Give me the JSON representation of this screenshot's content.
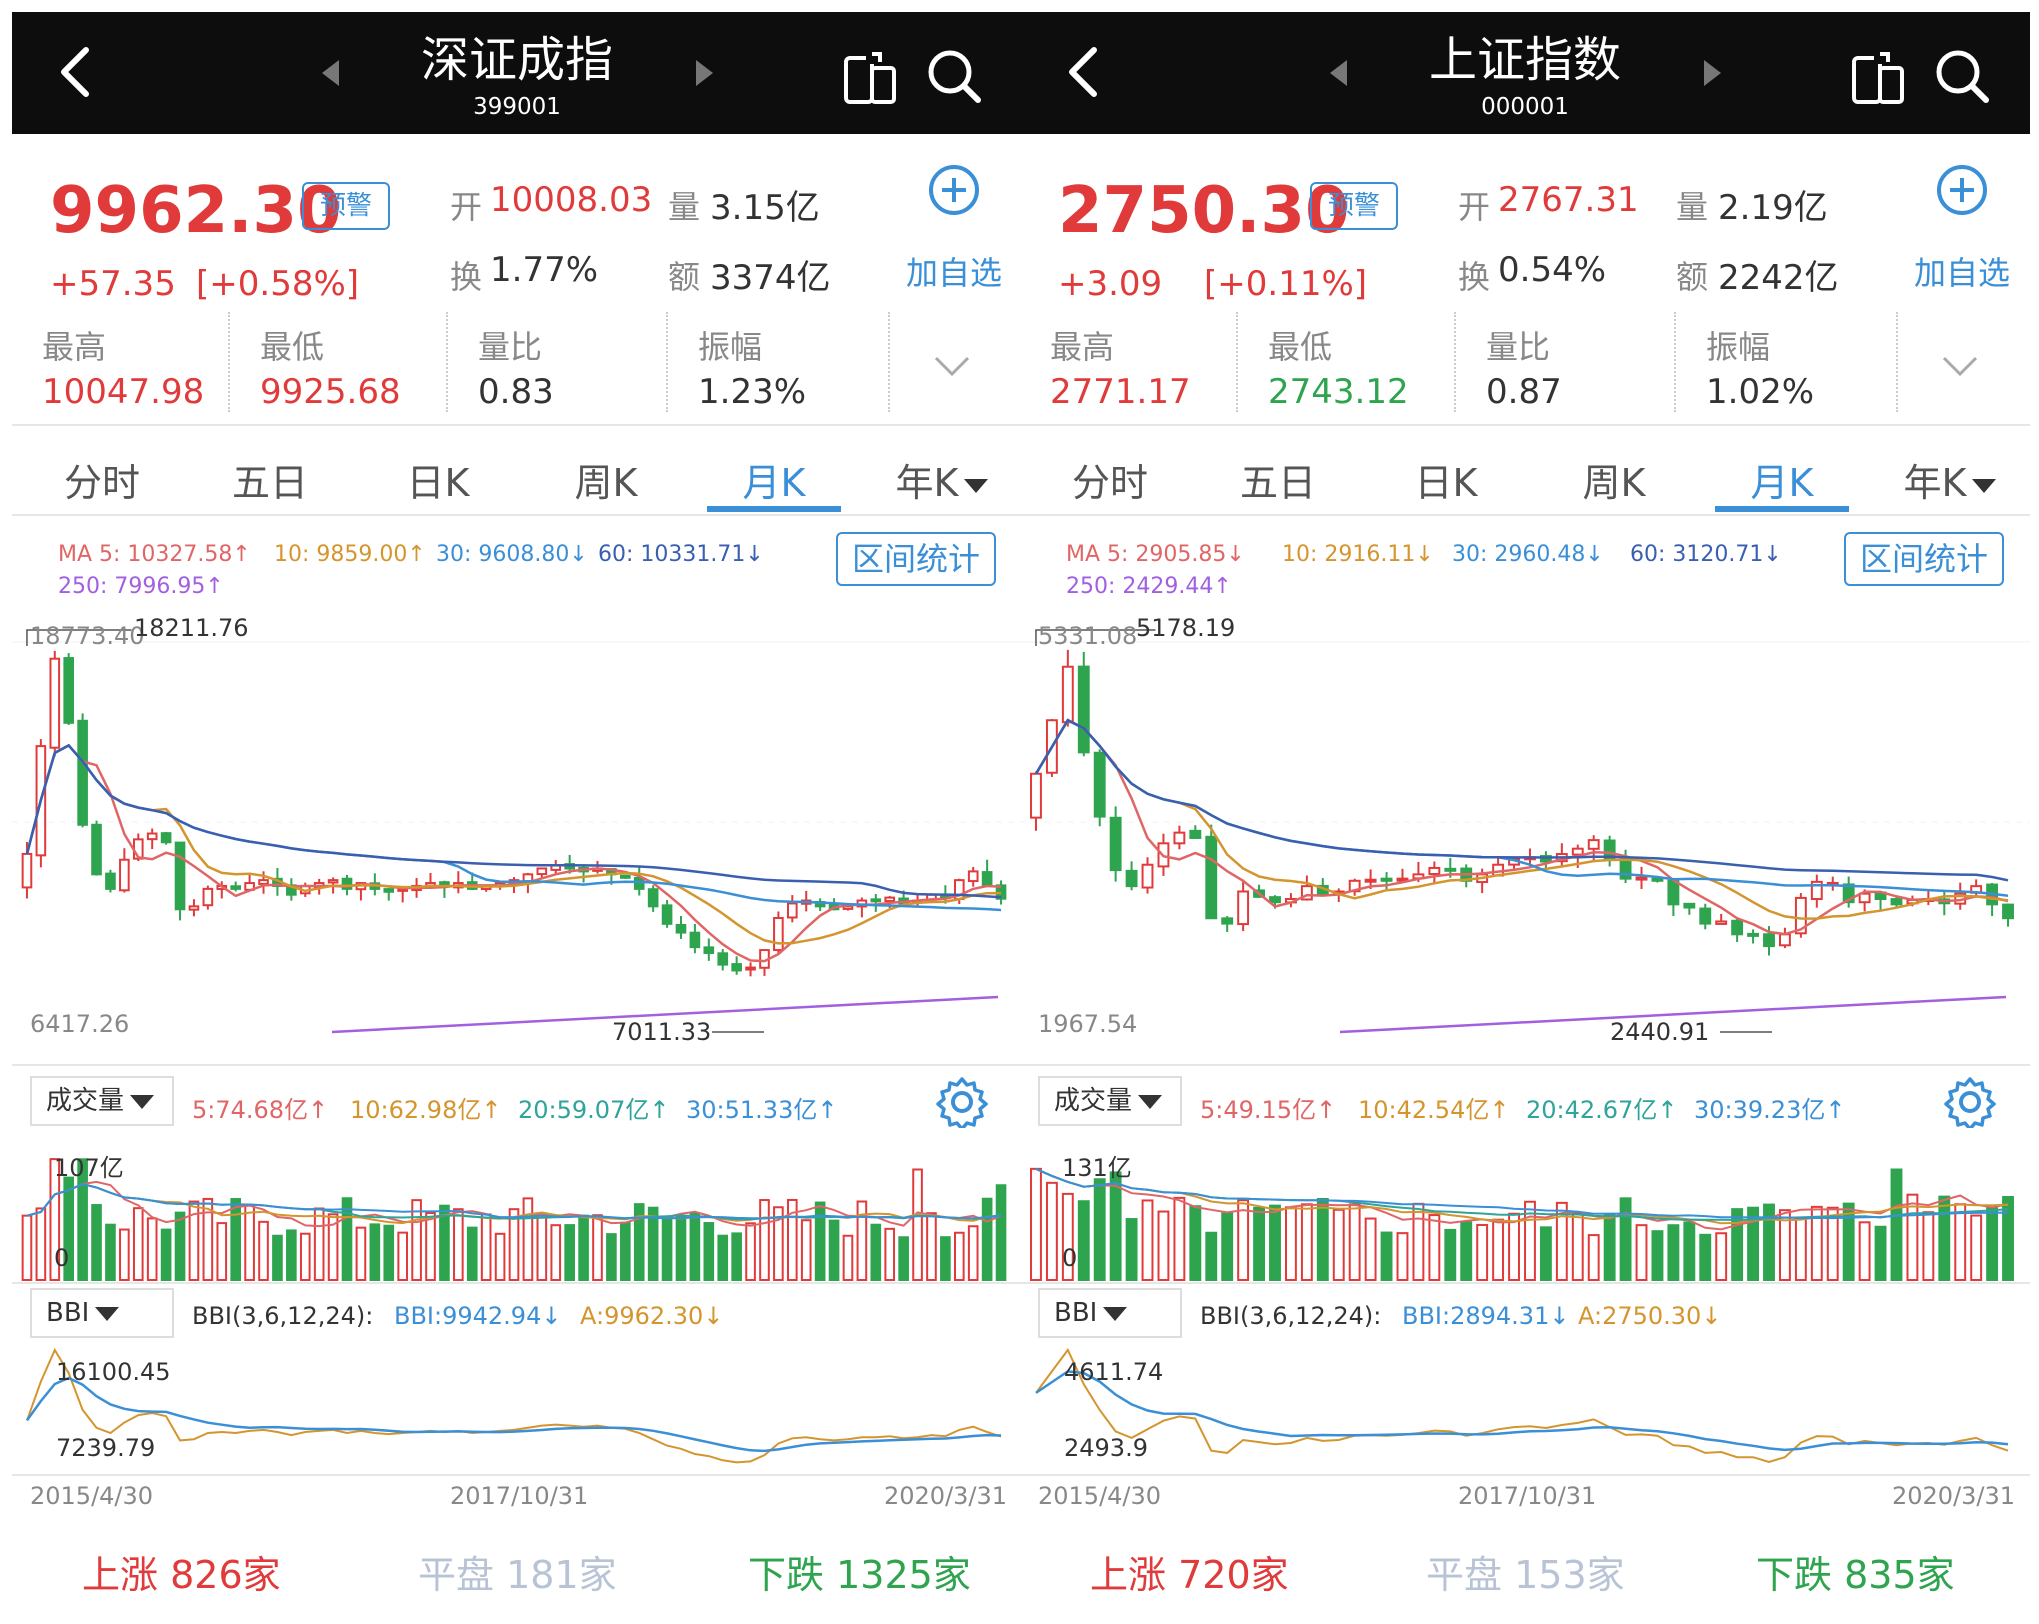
{
  "panels": [
    {
      "title": "深证成指",
      "code": "399001",
      "price": "9962.30",
      "alert_label": "预警",
      "change": "+57.35",
      "change_pct": "[+0.58%]",
      "open_label": "开",
      "open": "10008.03",
      "vol_label": "量",
      "vol": "3.15亿",
      "turnover_label": "换",
      "turnover": "1.77%",
      "amount_label": "额",
      "amount": "3374亿",
      "add_label": "加自选",
      "high_label": "最高",
      "high": "10047.98",
      "low_label": "最低",
      "low": "9925.68",
      "volratio_label": "量比",
      "volratio": "0.83",
      "amp_label": "振幅",
      "amp": "1.23%",
      "tabs": [
        "分时",
        "五日",
        "日K",
        "周K",
        "月K",
        "年K"
      ],
      "active_tab": 4,
      "ma": {
        "ma5": "MA 5: 10327.58↑",
        "ma10": "10: 9859.00↑",
        "ma30": "30: 9608.80↓",
        "ma60": "60: 10331.71↓",
        "ma250": "250: 7996.95↑"
      },
      "range_btn": "区间统计",
      "k_max": "18773.40",
      "k_peak": "18211.76",
      "k_min_axis": "6417.26",
      "k_low": "7011.33",
      "vol_dropdown": "成交量",
      "vol_ma": {
        "v5": "5:74.68亿↑",
        "v10": "10:62.98亿↑",
        "v20": "20:59.07亿↑",
        "v30": "30:51.33亿↑"
      },
      "vol_max": "107亿",
      "vol_zero": "0",
      "bbi_dropdown": "BBI",
      "bbi_params": "BBI(3,6,12,24):",
      "bbi_val": "BBI:9942.94↓",
      "bbi_a": "A:9962.30↓",
      "bbi_max": "16100.45",
      "bbi_min": "7239.79",
      "dates": [
        "2015/4/30",
        "2017/10/31",
        "2020/3/31"
      ],
      "up_label": "上涨",
      "up": "826家",
      "flat_label": "平盘",
      "flat": "181家",
      "down_label": "下跌",
      "down": "1325家",
      "chart_data": {
        "type": "candlestick",
        "note_range": [
          6417.26,
          18773.4
        ],
        "monthly_close_approx": [
          11500,
          15200,
          18200,
          16000,
          12500,
          10800,
          10300,
          11300,
          12000,
          12200,
          11900,
          9600,
          9700,
          10300,
          10400,
          10300,
          10500,
          10600,
          10400,
          10100,
          10400,
          10500,
          10600,
          10300,
          10500,
          10300,
          10200,
          10300,
          10400,
          10500,
          10400,
          10500,
          10300,
          10400,
          10500,
          10600,
          10800,
          11000,
          11100,
          11000,
          10900,
          11000,
          10800,
          10700,
          10300,
          9700,
          9100,
          8800,
          8300,
          8100,
          7700,
          7500,
          7600,
          8200,
          9300,
          9800,
          9900,
          9700,
          9600,
          9700,
          9900,
          9900,
          10000,
          9800,
          9900,
          10100,
          10000,
          10600,
          10900,
          10400,
          9962.3
        ]
      }
    },
    {
      "title": "上证指数",
      "code": "000001",
      "price": "2750.30",
      "alert_label": "预警",
      "change": "+3.09",
      "change_pct": "[+0.11%]",
      "open_label": "开",
      "open": "2767.31",
      "vol_label": "量",
      "vol": "2.19亿",
      "turnover_label": "换",
      "turnover": "0.54%",
      "amount_label": "额",
      "amount": "2242亿",
      "add_label": "加自选",
      "high_label": "最高",
      "high": "2771.17",
      "low_label": "最低",
      "low": "2743.12",
      "volratio_label": "量比",
      "volratio": "0.87",
      "amp_label": "振幅",
      "amp": "1.02%",
      "tabs": [
        "分时",
        "五日",
        "日K",
        "周K",
        "月K",
        "年K"
      ],
      "active_tab": 4,
      "ma": {
        "ma5": "MA 5: 2905.85↓",
        "ma10": "10: 2916.11↓",
        "ma30": "30: 2960.48↓",
        "ma60": "60: 3120.71↓",
        "ma250": "250: 2429.44↑"
      },
      "range_btn": "区间统计",
      "k_max": "5331.08",
      "k_peak": "5178.19",
      "k_min_axis": "1967.54",
      "k_low": "2440.91",
      "vol_dropdown": "成交量",
      "vol_ma": {
        "v5": "5:49.15亿↑",
        "v10": "10:42.54亿↑",
        "v20": "20:42.67亿↑",
        "v30": "30:39.23亿↑"
      },
      "vol_max": "131亿",
      "vol_zero": "0",
      "bbi_dropdown": "BBI",
      "bbi_params": "BBI(3,6,12,24):",
      "bbi_val": "BBI:2894.31↓",
      "bbi_a": "A:2750.30↓",
      "bbi_max": "4611.74",
      "bbi_min": "2493.9",
      "dates": [
        "2015/4/30",
        "2017/10/31",
        "2020/3/31"
      ],
      "up_label": "上涨",
      "up": "720家",
      "flat_label": "平盘",
      "flat": "153家",
      "down_label": "下跌",
      "down": "835家",
      "chart_data": {
        "type": "candlestick",
        "note_range": [
          1967.54,
          5331.08
        ],
        "monthly_close_approx": [
          4100,
          4600,
          5100,
          4300,
          3700,
          3200,
          3050,
          3250,
          3450,
          3550,
          3500,
          2750,
          2700,
          3000,
          2950,
          2900,
          2930,
          3050,
          2980,
          3000,
          3100,
          3110,
          3100,
          3120,
          3160,
          3220,
          3200,
          3100,
          3160,
          3250,
          3300,
          3320,
          3280,
          3350,
          3400,
          3480,
          3300,
          3120,
          3130,
          3100,
          2880,
          2850,
          2700,
          2720,
          2600,
          2600,
          2490,
          2600,
          2940,
          3090,
          3080,
          2900,
          2980,
          2930,
          2880,
          2920,
          2930,
          2890,
          2980,
          3050,
          2880,
          2750.3
        ]
      }
    }
  ],
  "colors": {
    "up": "#e03a3a",
    "down": "#2ea44f",
    "accent": "#3a8fd6",
    "ma10": "#d4952e",
    "ma30": "#3a8fd6",
    "ma60": "#3a5fb0",
    "ma250": "#a25fe0"
  }
}
